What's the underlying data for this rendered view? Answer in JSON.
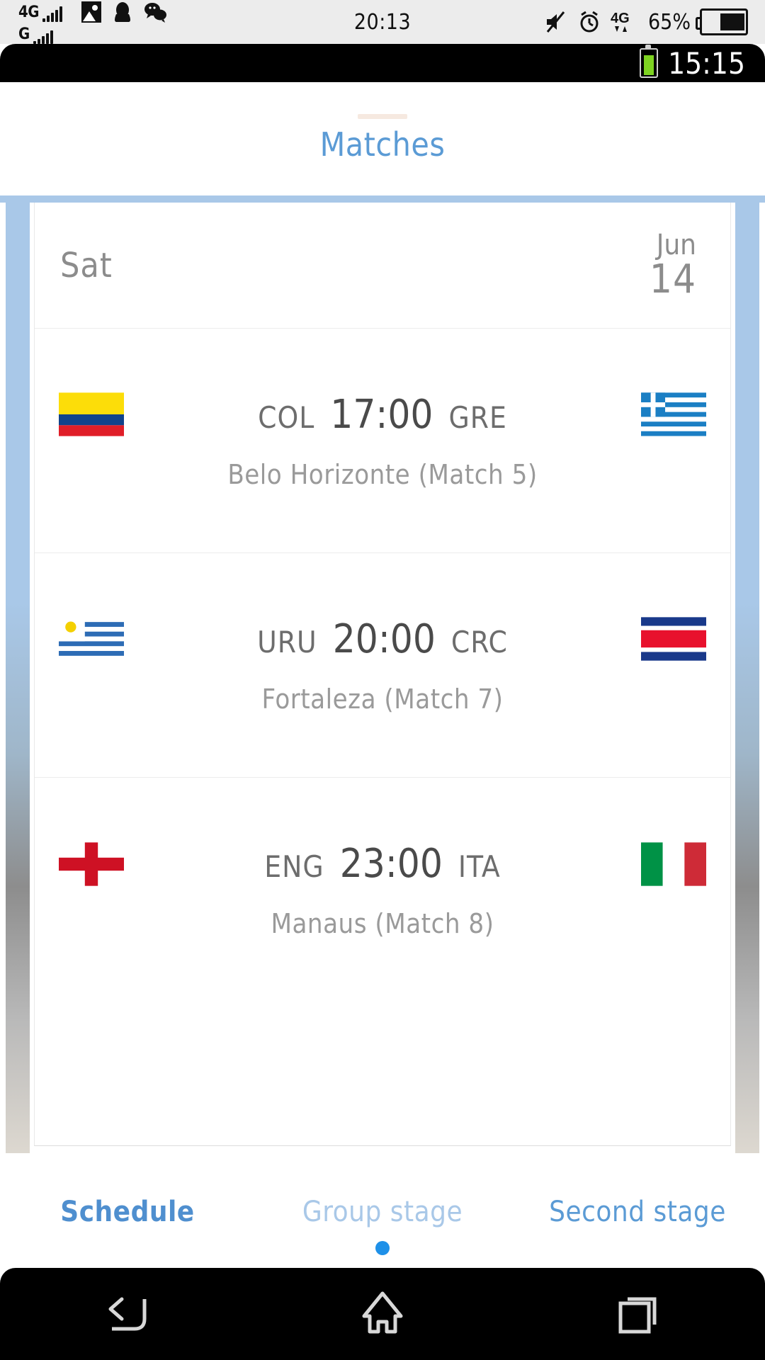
{
  "os_statusbar": {
    "network_primary": "4G",
    "network_secondary": "G",
    "clock": "20:13",
    "battery_percent": "65%",
    "icons": [
      "photo-icon",
      "qq-penguin-icon",
      "wechat-icon",
      "mute-icon",
      "alarm-icon",
      "4g-data-icon",
      "battery-icon"
    ]
  },
  "app_statusbar": {
    "clock": "15:15",
    "battery_icon": "battery-icon"
  },
  "header": {
    "title": "Matches"
  },
  "schedule": {
    "date": {
      "day_of_week": "Sat",
      "month": "Jun",
      "day": "14"
    },
    "matches": [
      {
        "home_code": "COL",
        "away_code": "GRE",
        "time": "17:00",
        "venue": "Belo Horizonte (Match  5)",
        "home_flag": "colombia-flag",
        "away_flag": "greece-flag"
      },
      {
        "home_code": "URU",
        "away_code": "CRC",
        "time": "20:00",
        "venue": "Fortaleza (Match  7)",
        "home_flag": "uruguay-flag",
        "away_flag": "costa-rica-flag"
      },
      {
        "home_code": "ENG",
        "away_code": "ITA",
        "time": "23:00",
        "venue": "Manaus (Match  8)",
        "home_flag": "england-flag",
        "away_flag": "italy-flag"
      }
    ]
  },
  "tabs": [
    {
      "label": "Schedule",
      "state": "active"
    },
    {
      "label": "Group stage",
      "state": "dim"
    },
    {
      "label": "Second stage",
      "state": "normal"
    }
  ],
  "navbar": {
    "back": "back-icon",
    "home": "home-icon",
    "recents": "recent-apps-icon"
  },
  "colors": {
    "accent_blue": "#5b9bd5",
    "frame_blue": "#a9c8e8",
    "dot_blue": "#1e90e8",
    "text_gray": "#8c8c8c"
  }
}
